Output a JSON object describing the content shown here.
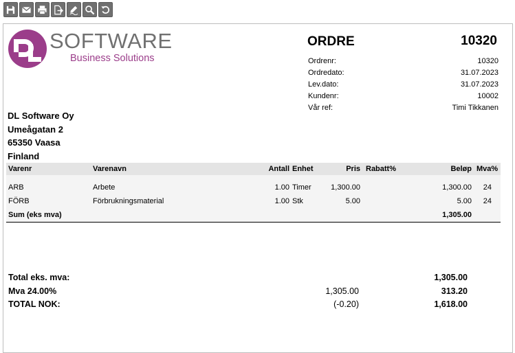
{
  "toolbar": {
    "buttons": [
      {
        "icon": "save-icon"
      },
      {
        "icon": "email-icon"
      },
      {
        "icon": "print-icon"
      },
      {
        "icon": "export-icon"
      },
      {
        "icon": "sign-icon"
      },
      {
        "icon": "zoom-icon"
      },
      {
        "icon": "refresh-icon"
      }
    ]
  },
  "brand": {
    "name": "SOFTWARE",
    "subtitle": "Business Solutions",
    "accent_color": "#9b3d8a",
    "logo_gray": "#707070"
  },
  "document": {
    "title": "ORDRE",
    "number": "10320",
    "meta": [
      {
        "label": "Ordrenr:",
        "value": "10320"
      },
      {
        "label": "Ordredato:",
        "value": "31.07.2023"
      },
      {
        "label": "Lev.dato:",
        "value": "31.07.2023"
      },
      {
        "label": "Kundenr:",
        "value": "10002"
      },
      {
        "label": "Vår ref:",
        "value": "Timi Tikkanen"
      }
    ]
  },
  "address": {
    "line1": "DL Software Oy",
    "line2": "Umeågatan 2",
    "line3": "65350 Vaasa",
    "line4": "Finland"
  },
  "table": {
    "headers": {
      "varenr": "Varenr",
      "varenavn": "Varenavn",
      "antall": "Antall",
      "enhet": "Enhet",
      "pris": "Pris",
      "rabatt": "Rabatt%",
      "belop": "Beløp",
      "mva": "Mva%"
    },
    "rows": [
      {
        "varenr": "ARB",
        "varenavn": "Arbete",
        "antall": "1.00",
        "enhet": "Timer",
        "pris": "1,300.00",
        "rabatt": "",
        "belop": "1,300.00",
        "mva": "24"
      },
      {
        "varenr": "FÖRB",
        "varenavn": "Förbrukningsmaterial",
        "antall": "1.00",
        "enhet": "Stk",
        "pris": "5.00",
        "rabatt": "",
        "belop": "5.00",
        "mva": "24"
      }
    ],
    "sum": {
      "label": "Sum (eks mva)",
      "value": "1,305.00"
    }
  },
  "totals": {
    "ex_vat": {
      "label": "Total eks. mva:",
      "value": "1,305.00"
    },
    "vat": {
      "label": "Mva 24.00%",
      "base": "1,305.00",
      "value": "313.20"
    },
    "total": {
      "label": "TOTAL NOK:",
      "rounding": "(-0.20)",
      "value": "1,618.00"
    }
  }
}
